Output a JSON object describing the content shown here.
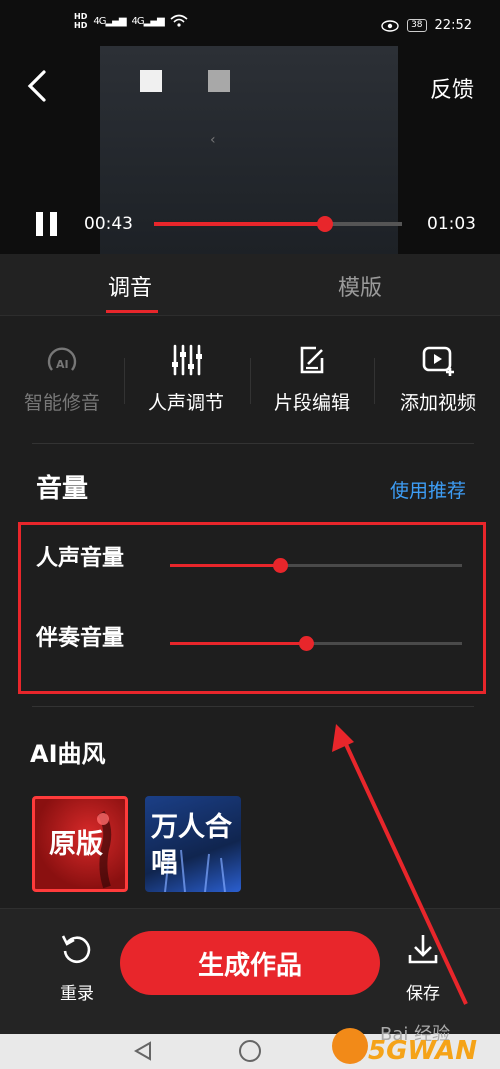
{
  "status_bar": {
    "hd1": "HD",
    "hd2": "HD",
    "net1": "4G",
    "net2": "4G",
    "battery": "38",
    "time": "22:52"
  },
  "header": {
    "feedback": "反馈"
  },
  "player": {
    "current_time": "00:43",
    "total_time": "01:03",
    "progress": 0.69
  },
  "tabs": [
    {
      "label": "调音",
      "active": true
    },
    {
      "label": "模版",
      "active": false
    }
  ],
  "tools": [
    {
      "label": "智能修音",
      "icon": "ai-tune-icon",
      "enabled": false
    },
    {
      "label": "人声调节",
      "icon": "equalizer-icon",
      "enabled": true
    },
    {
      "label": "片段编辑",
      "icon": "edit-icon",
      "enabled": true
    },
    {
      "label": "添加视频",
      "icon": "add-video-icon",
      "enabled": true
    }
  ],
  "volume": {
    "title": "音量",
    "recommend": "使用推荐",
    "vocal_label": "人声音量",
    "vocal_level": 0.38,
    "accompany_label": "伴奏音量",
    "accompany_level": 0.47
  },
  "ai_style": {
    "title": "AI曲风",
    "options": [
      {
        "label": "原版",
        "selected": true
      },
      {
        "label": "万人合唱",
        "selected": false
      }
    ]
  },
  "actions": {
    "rerecord": "重录",
    "generate": "生成作品",
    "save": "保存"
  },
  "watermark": {
    "baidu": "Bai 经验",
    "brand": "5GWAN"
  },
  "colors": {
    "accent": "#e8262b",
    "link": "#3d9df5",
    "background": "#1e1e1e"
  }
}
